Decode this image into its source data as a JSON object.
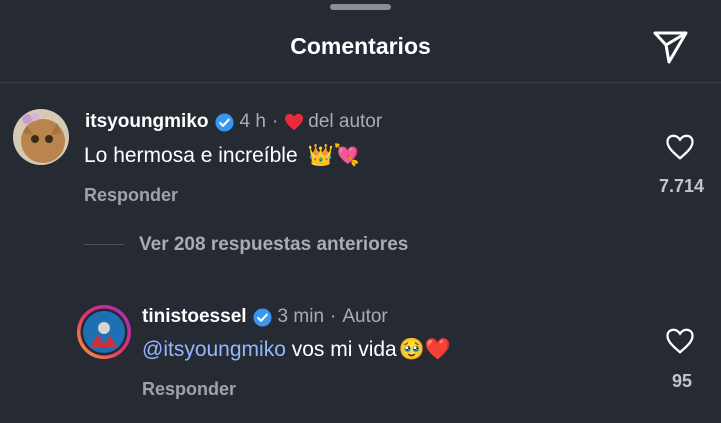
{
  "header": {
    "title": "Comentarios"
  },
  "comments": [
    {
      "username": "itsyoungmiko",
      "time": "4 h",
      "separator": "·",
      "liked_label": "del autor",
      "text": "Lo hermosa e increíble",
      "emoji": "👑💘",
      "reply_label": "Responder",
      "like_count": "7.714"
    },
    {
      "username": "tinistoessel",
      "time": "3 min",
      "separator": "·",
      "author_label": "Autor",
      "mention": "@itsyoungmiko",
      "text": " vos mi vida",
      "emoji": "🥹❤️",
      "reply_label": "Responder",
      "like_count": "95"
    }
  ],
  "view_replies": "Ver 208 respuestas anteriores",
  "colors": {
    "background": "#262a33",
    "verified": "#3897f0",
    "heart_red": "#ed2a3c",
    "mention": "#93b8ff"
  },
  "icons": [
    "send-icon",
    "verified-icon",
    "heart-filled-icon",
    "heart-outline-icon"
  ]
}
